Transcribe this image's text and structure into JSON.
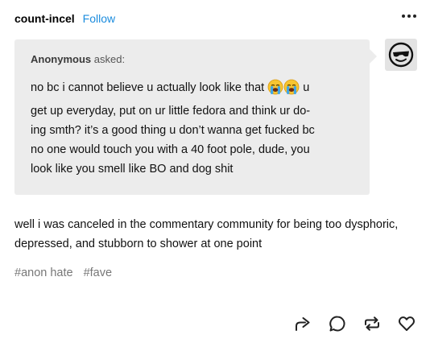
{
  "post": {
    "username": "count-incel",
    "follow_label": "Follow"
  },
  "ask": {
    "asker": "Anonymous",
    "asked_label": "asked:",
    "text_part1": "no bc i cannot believe u actually look like that ",
    "emoji": [
      "loudly-crying-face",
      "loudly-crying-face"
    ],
    "text_part2": " u\nget up everyday, put on ur little fedora and think ur do-\ning smth? it’s a good thing u don’t wanna get fucked bc\nno one would touch you with a 40 foot pole, dude, you\nlook like you smell like BO and dog shit"
  },
  "body": "well i was canceled in the commentary community for being too dysphoric, depressed, and stubborn to shower at one point",
  "tags": [
    "#anon hate",
    "#fave"
  ],
  "actions": [
    "share-icon",
    "reply-icon",
    "reblog-icon",
    "like-icon"
  ],
  "colors": {
    "follow": "#1b8cde",
    "ask_bg": "#ececec",
    "tag": "#777777"
  }
}
